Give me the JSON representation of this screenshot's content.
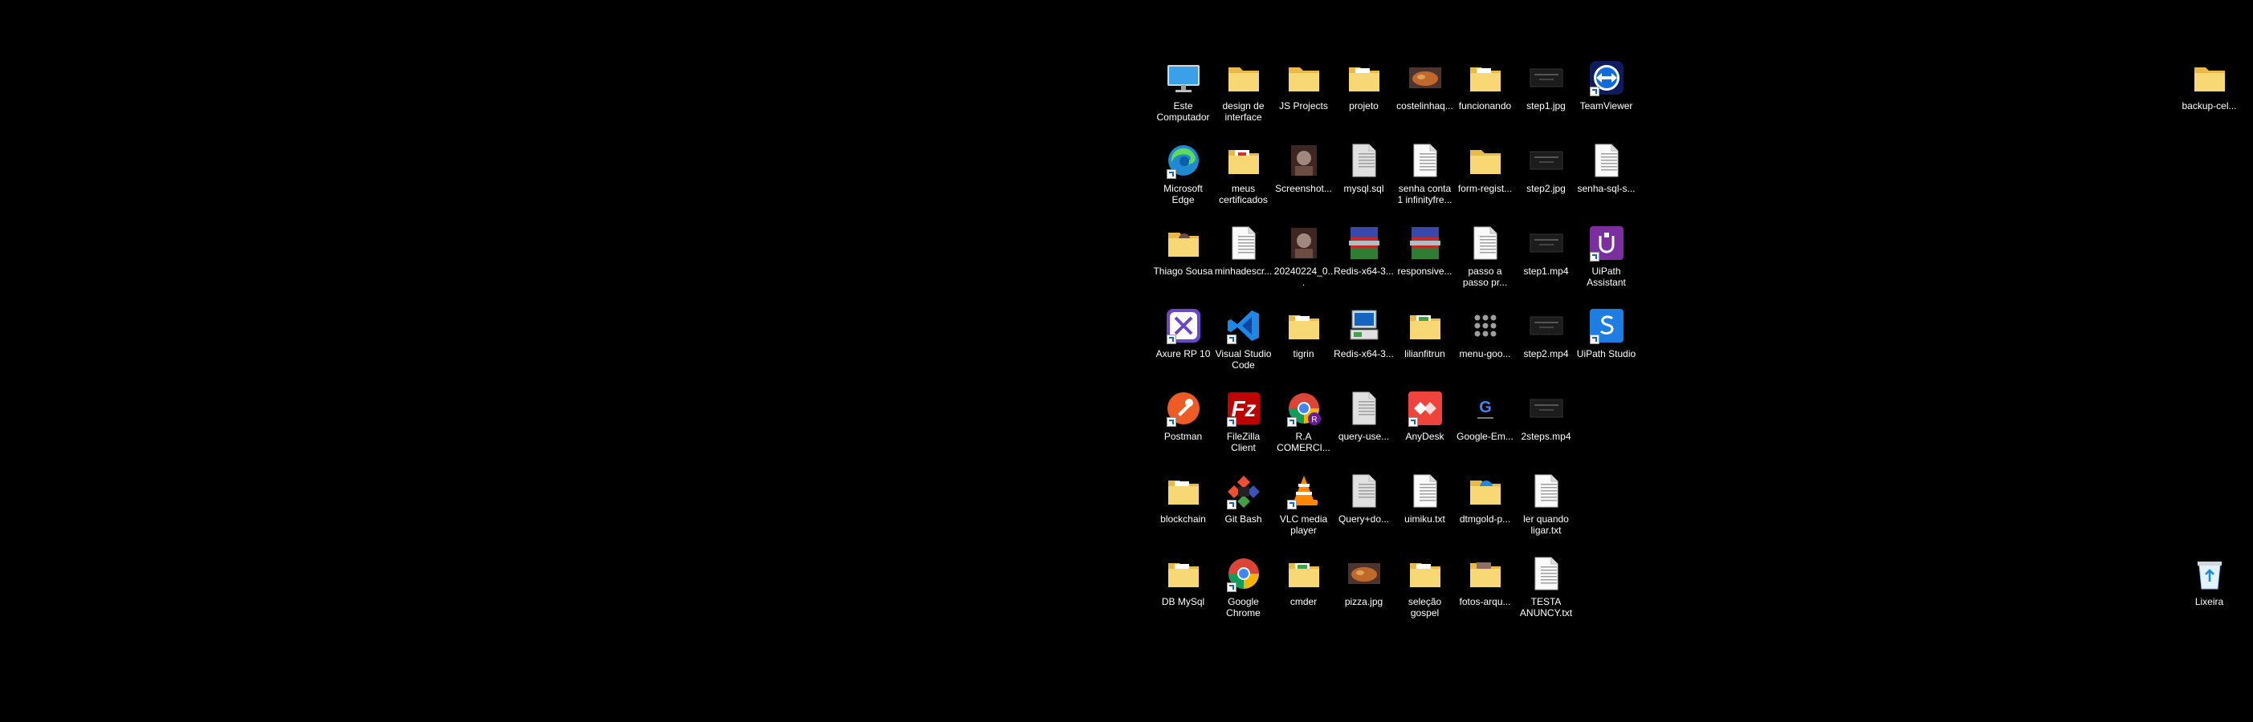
{
  "desktop": {
    "icons": [
      {
        "label": "Este Computador",
        "icon": "computer-icon",
        "type": "computer",
        "shortcut": false
      },
      {
        "label": "design de interface",
        "icon": "folder-icon",
        "type": "folder",
        "shortcut": false
      },
      {
        "label": "JS Projects",
        "icon": "folder-icon",
        "type": "folder",
        "shortcut": false
      },
      {
        "label": "projeto",
        "icon": "folder-icon",
        "type": "folder-doc",
        "shortcut": false
      },
      {
        "label": "costelinhaq...",
        "icon": "image-file-icon",
        "type": "photo-food",
        "shortcut": false
      },
      {
        "label": "funcionando",
        "icon": "folder-icon",
        "type": "folder-doc",
        "shortcut": false
      },
      {
        "label": "step1.jpg",
        "icon": "image-file-icon",
        "type": "dark-image",
        "shortcut": false
      },
      {
        "label": "TeamViewer",
        "icon": "teamviewer-icon",
        "type": "teamviewer",
        "shortcut": true
      },
      {
        "label": "Microsoft Edge",
        "icon": "edge-icon",
        "type": "edge",
        "shortcut": true
      },
      {
        "label": "meus certificados",
        "icon": "folder-icon",
        "type": "folder-red",
        "shortcut": false
      },
      {
        "label": "Screenshot...",
        "icon": "image-file-icon",
        "type": "photo-person",
        "shortcut": false
      },
      {
        "label": "mysql.sql",
        "icon": "sql-file-icon",
        "type": "sql",
        "shortcut": false
      },
      {
        "label": "senha conta 1 infinityfre...",
        "icon": "text-file-icon",
        "type": "txt",
        "shortcut": false
      },
      {
        "label": "form-regist...",
        "icon": "folder-icon",
        "type": "folder",
        "shortcut": false
      },
      {
        "label": "step2.jpg",
        "icon": "image-file-icon",
        "type": "dark-image",
        "shortcut": false
      },
      {
        "label": "senha-sql-s...",
        "icon": "text-file-icon",
        "type": "txt",
        "shortcut": false
      },
      {
        "label": "Thiago Sousa",
        "icon": "folder-icon",
        "type": "folder-person",
        "shortcut": false
      },
      {
        "label": "minhadescr...",
        "icon": "text-file-icon",
        "type": "txt",
        "shortcut": false
      },
      {
        "label": "20240224_0...",
        "icon": "image-file-icon",
        "type": "photo-person",
        "shortcut": false
      },
      {
        "label": "Redis-x64-3...",
        "icon": "archive-icon",
        "type": "winrar",
        "shortcut": false
      },
      {
        "label": "responsive...",
        "icon": "archive-icon",
        "type": "winrar",
        "shortcut": false
      },
      {
        "label": "passo a passo pr...",
        "icon": "text-file-icon",
        "type": "txt",
        "shortcut": false
      },
      {
        "label": "step1.mp4",
        "icon": "video-file-icon",
        "type": "dark-image",
        "shortcut": false
      },
      {
        "label": "UiPath Assistant",
        "icon": "uipath-icon",
        "type": "uipath-assistant",
        "shortcut": true
      },
      {
        "label": "Axure RP 10",
        "icon": "axure-icon",
        "type": "axure",
        "shortcut": true
      },
      {
        "label": "Visual Studio Code",
        "icon": "vscode-icon",
        "type": "vscode",
        "shortcut": true
      },
      {
        "label": "tigrin",
        "icon": "folder-icon",
        "type": "folder-doc",
        "shortcut": false
      },
      {
        "label": "Redis-x64-3...",
        "icon": "installer-icon",
        "type": "installer",
        "shortcut": false
      },
      {
        "label": "lilianfitrun",
        "icon": "folder-icon",
        "type": "folder-green",
        "shortcut": false
      },
      {
        "label": "menu-goo...",
        "icon": "app-grid-icon",
        "type": "grid",
        "shortcut": false
      },
      {
        "label": "step2.mp4",
        "icon": "video-file-icon",
        "type": "dark-image",
        "shortcut": false
      },
      {
        "label": "UiPath Studio",
        "icon": "uipath-icon",
        "type": "uipath-studio",
        "shortcut": true
      },
      {
        "label": "Postman",
        "icon": "postman-icon",
        "type": "postman",
        "shortcut": true
      },
      {
        "label": "FileZilla Client",
        "icon": "filezilla-icon",
        "type": "filezilla",
        "shortcut": true
      },
      {
        "label": "R.A COMERCI...",
        "icon": "chrome-profile-icon",
        "type": "chrome-r",
        "shortcut": true
      },
      {
        "label": "query-use...",
        "icon": "sql-file-icon",
        "type": "sql",
        "shortcut": false
      },
      {
        "label": "AnyDesk",
        "icon": "anydesk-icon",
        "type": "anydesk",
        "shortcut": true
      },
      {
        "label": "Google-Em...",
        "icon": "google-file-icon",
        "type": "google",
        "shortcut": false
      },
      {
        "label": "2steps.mp4",
        "icon": "video-file-icon",
        "type": "dark-image",
        "shortcut": false
      },
      {
        "label": "",
        "icon": "",
        "type": "empty",
        "shortcut": false
      },
      {
        "label": "blockchain",
        "icon": "folder-icon",
        "type": "folder-doc",
        "shortcut": false
      },
      {
        "label": "Git Bash",
        "icon": "git-bash-icon",
        "type": "gitbash",
        "shortcut": true
      },
      {
        "label": "VLC media player",
        "icon": "vlc-icon",
        "type": "vlc",
        "shortcut": true
      },
      {
        "label": "Query+do...",
        "icon": "sql-file-icon",
        "type": "sql",
        "shortcut": false
      },
      {
        "label": "uimiku.txt",
        "icon": "text-file-icon",
        "type": "txt",
        "shortcut": false
      },
      {
        "label": "dtmgold-p...",
        "icon": "folder-icon",
        "type": "folder-edge",
        "shortcut": false
      },
      {
        "label": "ler quando ligar.txt",
        "icon": "text-file-icon",
        "type": "txt",
        "shortcut": false
      },
      {
        "label": "",
        "icon": "",
        "type": "empty",
        "shortcut": false
      },
      {
        "label": "DB MySql",
        "icon": "folder-icon",
        "type": "folder-doc",
        "shortcut": false
      },
      {
        "label": "Google Chrome",
        "icon": "chrome-icon",
        "type": "chrome",
        "shortcut": true
      },
      {
        "label": "cmder",
        "icon": "folder-icon",
        "type": "folder-green",
        "shortcut": false
      },
      {
        "label": "pizza.jpg",
        "icon": "image-file-icon",
        "type": "photo-food",
        "shortcut": false
      },
      {
        "label": "seleção gospel",
        "icon": "folder-icon",
        "type": "folder-doc",
        "shortcut": false
      },
      {
        "label": "fotos-arqu...",
        "icon": "folder-icon",
        "type": "folder-photo",
        "shortcut": false
      },
      {
        "label": "TESTA ANUNCY.txt",
        "icon": "text-file-icon",
        "type": "txt",
        "shortcut": false
      },
      {
        "label": "",
        "icon": "",
        "type": "empty",
        "shortcut": false
      }
    ],
    "right_icons": [
      {
        "label": "backup-cel...",
        "icon": "folder-icon",
        "type": "folder",
        "shortcut": false
      },
      {
        "label": "Lixeira",
        "icon": "recycle-bin-icon",
        "type": "recycle",
        "shortcut": false
      }
    ]
  }
}
